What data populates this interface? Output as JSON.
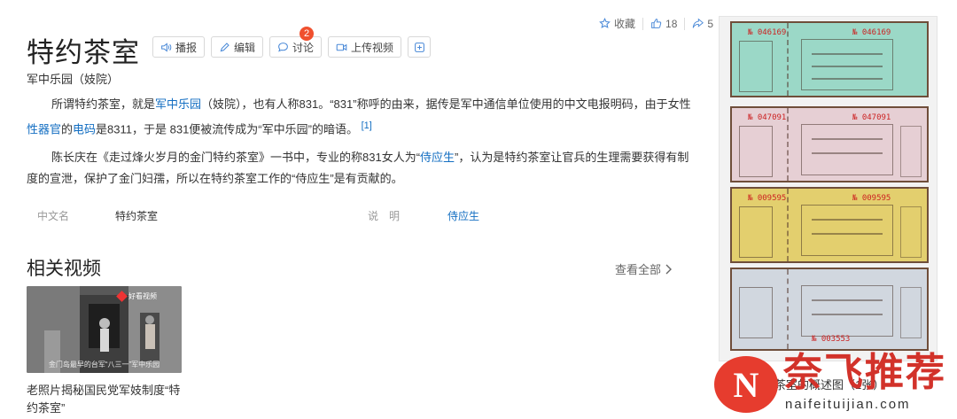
{
  "top_actions": {
    "favorite": "收藏",
    "likes": "18",
    "shares": "5"
  },
  "title": "特约茶室",
  "tools": {
    "broadcast": "播报",
    "edit": "编辑",
    "discuss": "讨论",
    "discuss_badge": "2",
    "upload": "上传视频"
  },
  "subtitle": "军中乐园（妓院）",
  "para1": {
    "t1": "所谓特约茶室，就是",
    "link1": "军中乐园",
    "t2": "（妓院），也有人称831。“831”称呼的由来，据传是军中通信单位使用的中文电报明码，由于女性",
    "link2": "性器官",
    "t3": "的",
    "link3": "电码",
    "t4": "是8311，于是 831便被流传成为“军中乐园”的暗语。",
    "ref": "[1]"
  },
  "para2": {
    "t1": "陈长庆在《走过烽火岁月的金门特约茶室》一书中，专业的称831女人为“",
    "link1": "侍应生",
    "t2": "”，认为是特约茶室让官兵的生理需要获得有制度的宣泄，保护了金门妇孺，所以在特约茶室工作的“侍应生”是有贡献的。"
  },
  "basic_info": [
    {
      "key": "中文名",
      "value": "特约茶室"
    },
    {
      "key": "说　明",
      "value": "侍应生"
    }
  ],
  "related": {
    "title": "相关视频",
    "see_all": "查看全部"
  },
  "video": {
    "thumb_logo": "好看视频",
    "thumb_caption": "金门岛最早的台军“八三一”军中乐园",
    "title": "老照片揭秘国民党军妓制度“特约茶室”"
  },
  "album": {
    "caption": "特约茶室的概述图（1张）",
    "ticket_numbers": [
      "№ 046169",
      "№ 047091",
      "№ 009595",
      "№ 003553"
    ]
  },
  "watermark": {
    "logo": "N",
    "text": "奈飞推荐",
    "url": "naifeituijian.com"
  },
  "colors": {
    "link": "#136ec2",
    "badge": "#f0502e",
    "watermark": "#d2322a"
  }
}
